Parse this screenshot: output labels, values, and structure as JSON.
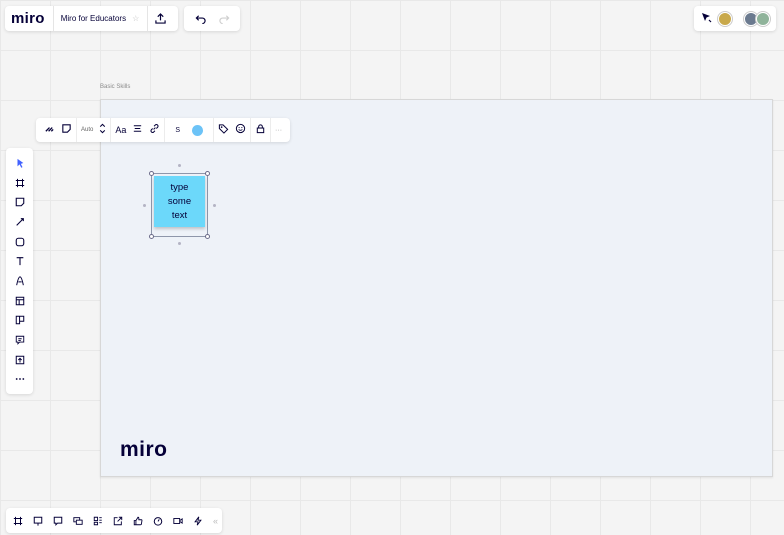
{
  "app": {
    "logo": "miro",
    "board_title": "Miro for Educators",
    "star": "☆"
  },
  "top_bar": {
    "icons": [
      "share-upload-icon",
      "undo-icon",
      "redo-icon"
    ]
  },
  "top_right": {
    "icons": [
      "cursor-toggle-icon"
    ],
    "avatars": [
      {
        "name": "avatar-1",
        "color": "#c9a94b"
      },
      {
        "name": "avatar-2",
        "color": "#6b7a8f"
      },
      {
        "name": "avatar-3",
        "color": "#8fb39a"
      }
    ]
  },
  "frame": {
    "label": "Basic Skills",
    "logo": "miro",
    "background": "#eef2f8"
  },
  "context_toolbar": {
    "font_size": "Auto",
    "font_label": "Aa",
    "size_label": "S",
    "color": "#6cc3f7",
    "more": "···"
  },
  "sticky": {
    "text": "type\nsome\ntext",
    "color": "#6cd8fa"
  },
  "left_toolbar": {
    "tools": [
      "select-icon",
      "frame-icon",
      "sticky-note-icon",
      "pen-icon",
      "shape-icon",
      "text-icon",
      "connection-line-icon",
      "template-icon",
      "card-icon",
      "comment-icon",
      "upload-icon",
      "more-tools-icon"
    ]
  },
  "bottom_toolbar": {
    "tools": [
      "frames-icon",
      "present-icon",
      "comments-icon",
      "screen-share-icon",
      "card-board-icon",
      "share-link-icon",
      "reactions-icon",
      "timer-icon",
      "video-icon",
      "power-ups-icon"
    ],
    "collapse": "«"
  }
}
